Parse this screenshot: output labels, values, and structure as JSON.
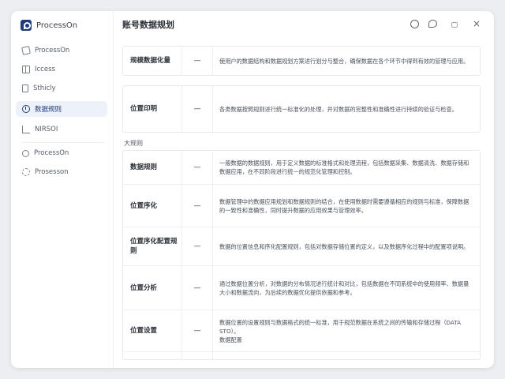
{
  "app": {
    "brand": "ProcessOn",
    "title": "账号数据规划"
  },
  "sidebar": {
    "items": [
      {
        "label": "ProcessOn",
        "icon": "tag-icon"
      },
      {
        "label": "Iccess",
        "icon": "book-icon"
      },
      {
        "label": "Sthicly",
        "icon": "document-icon"
      },
      {
        "label": "数据规则",
        "icon": "clock-icon",
        "active": true
      },
      {
        "label": "NIRSOI",
        "icon": "chart-icon"
      },
      {
        "label": "ProcessOn",
        "icon": "link-icon"
      },
      {
        "label": "Prosesson",
        "icon": "gear-icon"
      }
    ]
  },
  "toolbar": {
    "icons": [
      "refresh-icon",
      "chat-icon",
      "lock-icon",
      "close-icon"
    ],
    "close_glyph": "×"
  },
  "main": {
    "top_rows": [
      {
        "label": "规模数据化量",
        "dash": "—",
        "desc": "使用户的数据结构和数据规划方案进行划分与整合，确保数据在各个环节中得到有效的管理与应用。"
      },
      {
        "label": "位置印明",
        "dash": "—",
        "desc": "各类数据按照规则进行统一标准化的处理，并对数据的完整性和准确性进行持续的验证与检查。"
      }
    ],
    "section_label": "大规则",
    "rows": [
      {
        "label": "数据规则",
        "dash": "—",
        "desc": "一般数据的数据规则，用于定义数据的标准格式和处理流程，包括数据采集、数据清洗、数据存储和数据应用，在不同阶段进行统一的规范化管理和控制。"
      },
      {
        "label": "位置序化",
        "dash": "—",
        "desc": "数据管理中的数据应用规划和数据规则的结合，在使用数据时需要遵循相应的规则与标准，保障数据的一致性和准确性，同时提升数据的应用效果与管理效率。"
      },
      {
        "label": "位置序化配置规则",
        "dash": "—",
        "desc": "数据的位置信息和序化配置规则，包括对数据存储位置的定义，以及数据序化过程中的配置项说明。"
      },
      {
        "label": "位置分析",
        "dash": "—",
        "desc": "通过数据位置分析，对数据的分布情况进行统计和对比，包括数据在不同系统中的使用频率、数据量大小和数据流向，为后续的数据优化提供依据和参考。"
      },
      {
        "label": "位置设置",
        "dash": "—",
        "desc": "数据位置的设置规则与数据格式的统一标准，用于规范数据在系统之间的传输和存储过程（DATA STO）。",
        "desc2": "数据配置"
      },
      {
        "label": "",
        "dash": "",
        "desc": ""
      }
    ]
  }
}
